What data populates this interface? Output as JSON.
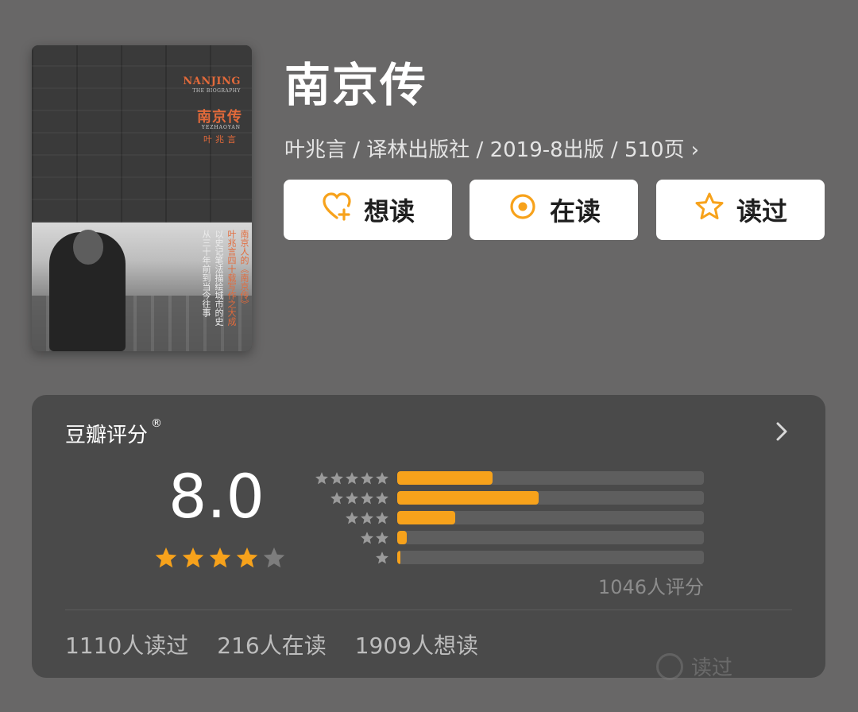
{
  "book": {
    "title": "南京传",
    "meta": "叶兆言 / 译林出版社 / 2019-8出版 / 510页",
    "meta_chevron": "›",
    "cover": {
      "en_title": "NANJING",
      "en_subtitle": "THE BIOGRAPHY",
      "zh_title": "南京传",
      "author_en": "YEZHAOYAN",
      "author_zh": "叶兆言",
      "vertical_lines": [
        "南京人的《南京传》",
        "叶兆言四十载写作之大成",
        "以史记笔法描绘城市的史",
        "从三十年前到当今往事"
      ]
    }
  },
  "actions": [
    {
      "label": "想读",
      "icon": "heart-plus-icon"
    },
    {
      "label": "在读",
      "icon": "target-circle-icon"
    },
    {
      "label": "读过",
      "icon": "star-outline-icon"
    }
  ],
  "rating": {
    "title": "豆瓣评分",
    "registered_mark": "®",
    "score": "8.0",
    "stars_filled": 4,
    "stars_total": 5,
    "distribution": [
      {
        "stars": 5,
        "fraction": 0.31
      },
      {
        "stars": 4,
        "fraction": 0.46
      },
      {
        "stars": 3,
        "fraction": 0.19
      },
      {
        "stars": 2,
        "fraction": 0.03
      },
      {
        "stars": 1,
        "fraction": 0.01
      }
    ],
    "count_text": "1046人评分",
    "accent_color": "#f7a21b"
  },
  "stats": {
    "read": "1110人读过",
    "reading": "216人在读",
    "want": "1909人想读"
  },
  "watermark": {
    "text": "读过"
  }
}
